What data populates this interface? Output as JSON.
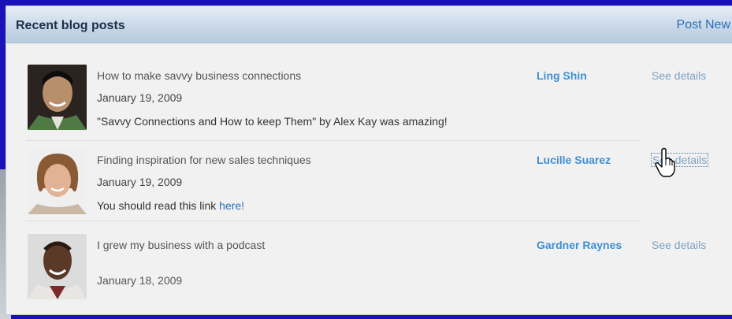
{
  "header": {
    "title": "Recent blog posts",
    "post_new": "Post New"
  },
  "posts": [
    {
      "title": "How to make savvy business connections",
      "date": "January 19, 2009",
      "excerpt": "\"Savvy Connections and How to keep Them\" by Alex Kay was amazing!",
      "author": "Ling Shin",
      "details": "See details"
    },
    {
      "title": "Finding inspiration for new sales techniques",
      "date": "January 19, 2009",
      "excerpt_prefix": "You should read this link ",
      "excerpt_link": "here!",
      "author": "Lucille Suarez",
      "details": "See details"
    },
    {
      "title": "I grew my business with a podcast",
      "date": "January 18, 2009",
      "author": "Gardner Raynes",
      "details": "See details"
    }
  ]
}
